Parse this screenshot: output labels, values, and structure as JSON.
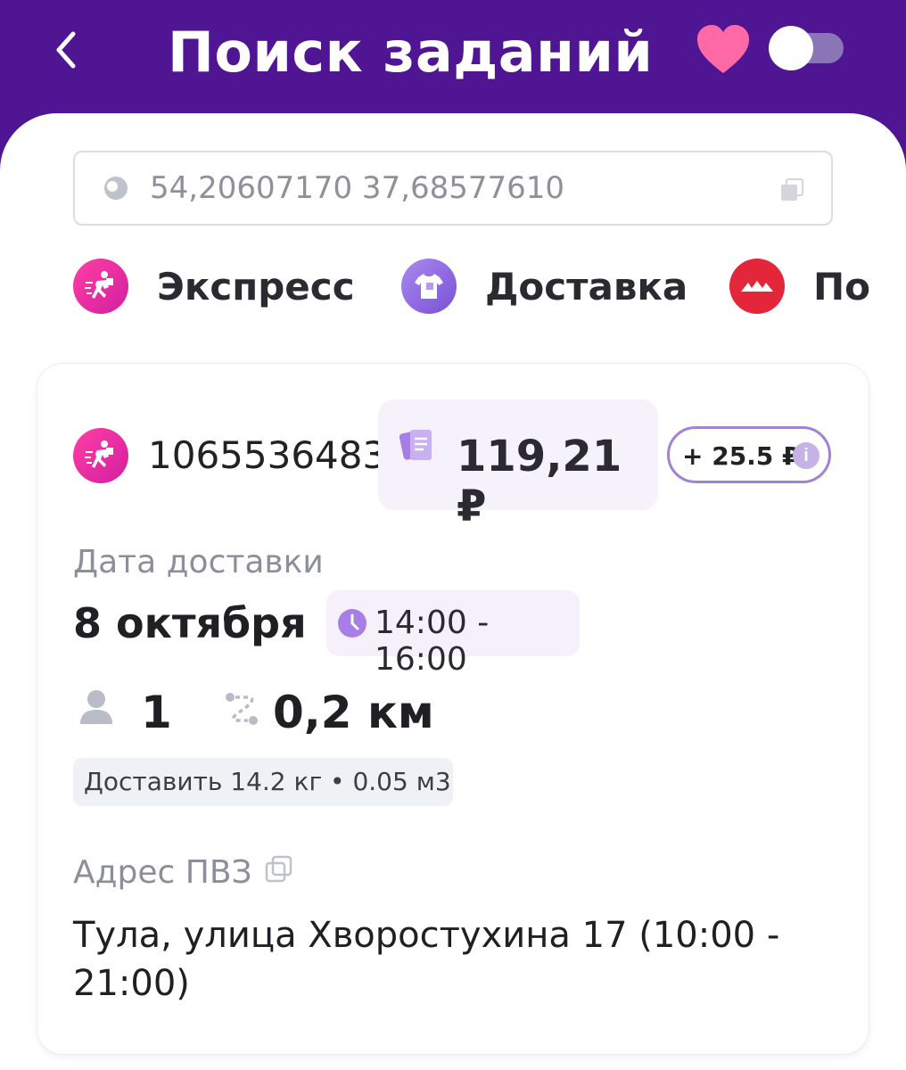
{
  "header": {
    "title": "Поиск заданий"
  },
  "search": {
    "value": "54,20607170 37,68577610"
  },
  "categories": [
    {
      "label": "Экспресс",
      "color": "#e8329c"
    },
    {
      "label": "Доставка",
      "color": "#8b63e0"
    },
    {
      "label": "По",
      "color": "#e3263a"
    }
  ],
  "order": {
    "id": "1065536483",
    "price": "119,21 ₽",
    "bonus": "+ 25.5 ₽",
    "date_label": "Дата доставки",
    "date": "8 октября",
    "time": "14:00 - 16:00",
    "persons": "1",
    "distance": "0,2 км",
    "deliver_info": "Доставить 14.2 кг • 0.05 м3",
    "address_label": "Адрес ПВЗ",
    "address": "Тула, улица Хворостухина 17 (10:00 - 21:00)"
  },
  "colors": {
    "header_bg": "#501592",
    "accent": "#a184d1"
  }
}
